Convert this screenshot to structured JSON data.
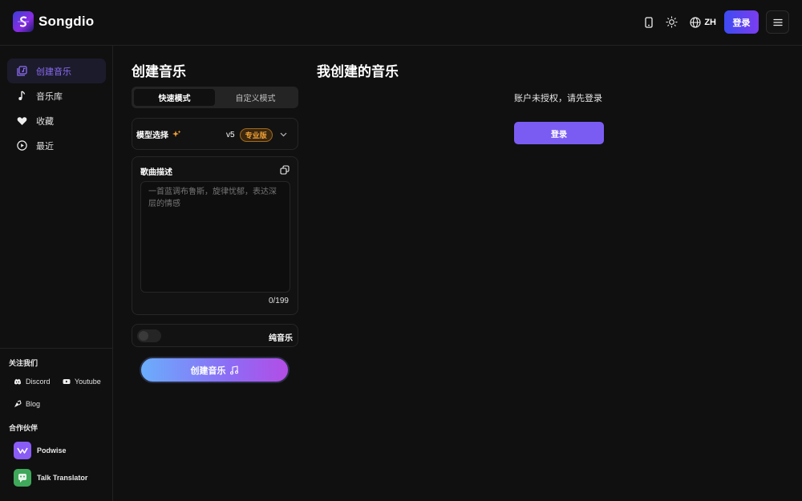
{
  "app": {
    "name": "Songdio"
  },
  "header": {
    "lang_label": "ZH",
    "login_label": "登录"
  },
  "sidebar": {
    "items": [
      {
        "label": "创建音乐",
        "icon": "music-add-icon",
        "active": true
      },
      {
        "label": "音乐库",
        "icon": "music-note-icon",
        "active": false
      },
      {
        "label": "收藏",
        "icon": "heart-icon",
        "active": false
      },
      {
        "label": "最近",
        "icon": "play-circle-icon",
        "active": false
      }
    ],
    "follow_title": "关注我们",
    "socials": [
      {
        "label": "Discord",
        "icon": "discord-icon"
      },
      {
        "label": "Youtube",
        "icon": "youtube-icon"
      },
      {
        "label": "Blog",
        "icon": "blog-icon"
      }
    ],
    "partners_title": "合作伙伴",
    "partners": [
      {
        "label": "Podwise",
        "color": "#8a5cf6"
      },
      {
        "label": "Talk Translator",
        "color": "#3fa85a"
      }
    ]
  },
  "create": {
    "title": "创建音乐",
    "tabs": [
      {
        "label": "快速模式",
        "active": true
      },
      {
        "label": "自定义模式",
        "active": false
      }
    ],
    "model_label": "模型选择",
    "model_version": "v5",
    "model_badge": "专业版",
    "desc_label": "歌曲描述",
    "desc_placeholder": "一首蓝调布鲁斯，旋律忧郁，表达深层的情感",
    "desc_count": "0/199",
    "instrumental_label": "纯音乐",
    "instrumental_on": false,
    "button_label": "创建音乐"
  },
  "my_music": {
    "title": "我创建的音乐",
    "auth_message": "账户未授权，请先登录",
    "login_label": "登录"
  },
  "colors": {
    "accent": "#7b5cf2",
    "pro_badge": "#f0a235",
    "background": "#101010"
  }
}
